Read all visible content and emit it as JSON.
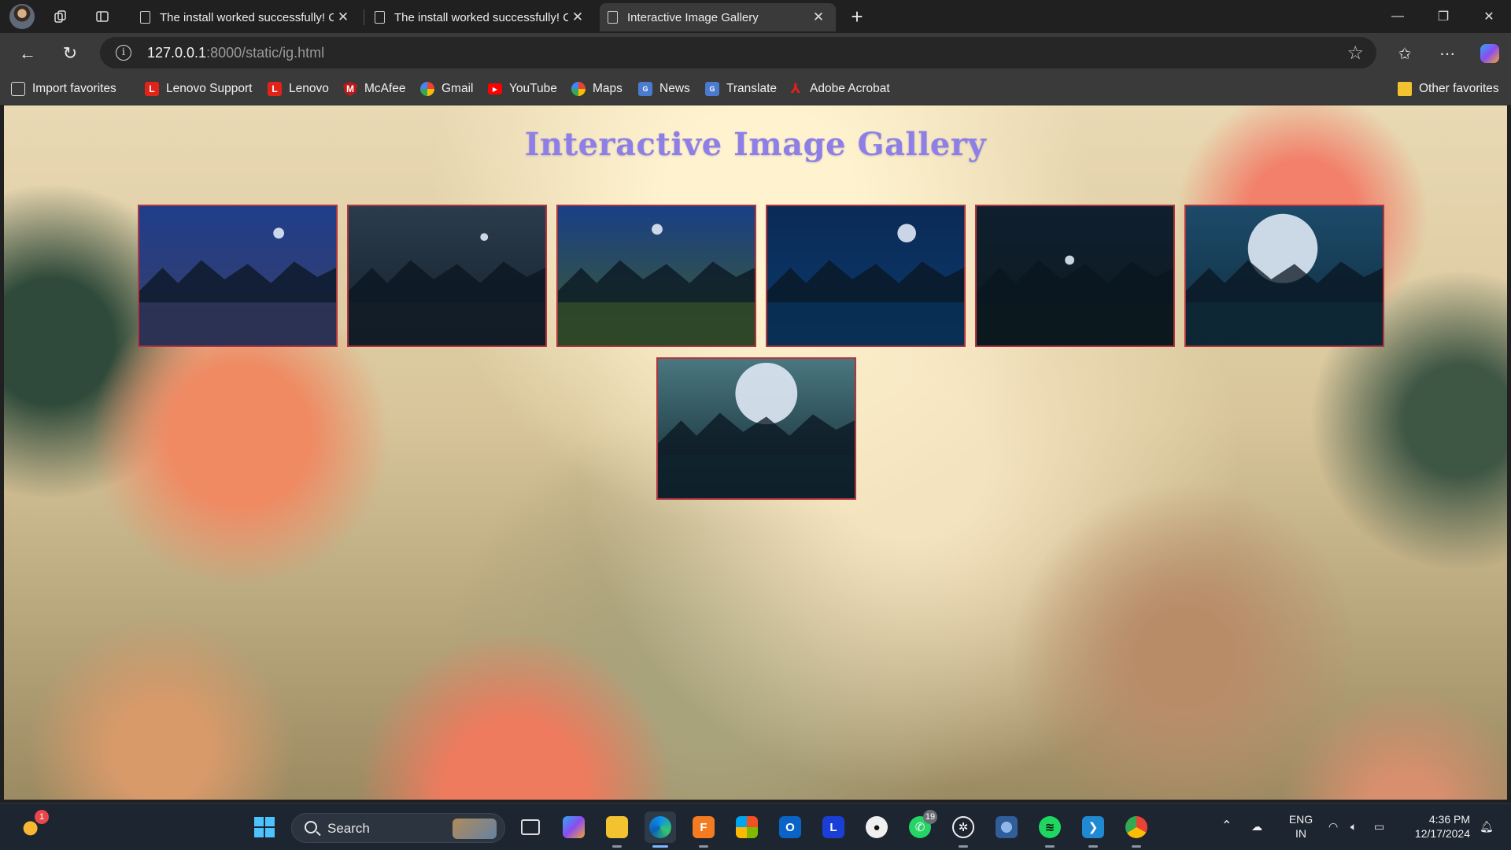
{
  "browser": {
    "tabs": [
      {
        "title": "The install worked successfully! Co",
        "active": false
      },
      {
        "title": "The install worked successfully! Co",
        "active": false
      },
      {
        "title": "Interactive Image Gallery",
        "active": true
      }
    ],
    "new_tab_label": "+",
    "address": {
      "host": "127.0.0.1",
      "rest": ":8000/static/ig.html"
    },
    "favorites": [
      {
        "label": "Import favorites",
        "icon": "import-icon",
        "color": "#3a3a3a"
      },
      {
        "label": "Lenovo Support",
        "icon": "lenovo-icon",
        "color": "#e2231a"
      },
      {
        "label": "Lenovo",
        "icon": "lenovo-icon",
        "color": "#e2231a"
      },
      {
        "label": "McAfee",
        "icon": "mcafee-icon",
        "color": "#c01818"
      },
      {
        "label": "Gmail",
        "icon": "google-icon",
        "color": "#4285f4"
      },
      {
        "label": "YouTube",
        "icon": "youtube-icon",
        "color": "#ff0000"
      },
      {
        "label": "Maps",
        "icon": "google-icon",
        "color": "#34a853"
      },
      {
        "label": "News",
        "icon": "news-icon",
        "color": "#4a7bd0"
      },
      {
        "label": "Translate",
        "icon": "translate-icon",
        "color": "#4a7bd0"
      },
      {
        "label": "Adobe Acrobat",
        "icon": "acrobat-icon",
        "color": "#d4161c"
      }
    ],
    "other_favorites": "Other favorites"
  },
  "page": {
    "title": "Interactive Image Gallery",
    "images": [
      {
        "name": "forest-night-moon",
        "sky": "#1f3e8a",
        "ground": "#3a3f6a"
      },
      {
        "name": "lake-reflection-night",
        "sky": "#2a3c4c",
        "ground": "#16202a"
      },
      {
        "name": "lake-pier-moon",
        "sky": "#1a3f86",
        "ground": "#3d5d2a"
      },
      {
        "name": "snow-mountain-moon",
        "sky": "#0b2a56",
        "ground": "#0a3a6c"
      },
      {
        "name": "dark-forest-moon",
        "sky": "#0f1f2e",
        "ground": "#0c1a1e"
      },
      {
        "name": "big-moon-trees",
        "sky": "#1d4a6a",
        "ground": "#0f2e3e"
      },
      {
        "name": "forest-full-moon",
        "sky": "#4a7780",
        "ground": "#10262e"
      }
    ]
  },
  "taskbar": {
    "search_label": "Search",
    "weather_badge": "1",
    "whatsapp_badge": "19",
    "lang_top": "ENG",
    "lang_bottom": "IN",
    "time": "4:36 PM",
    "date": "12/17/2024"
  }
}
